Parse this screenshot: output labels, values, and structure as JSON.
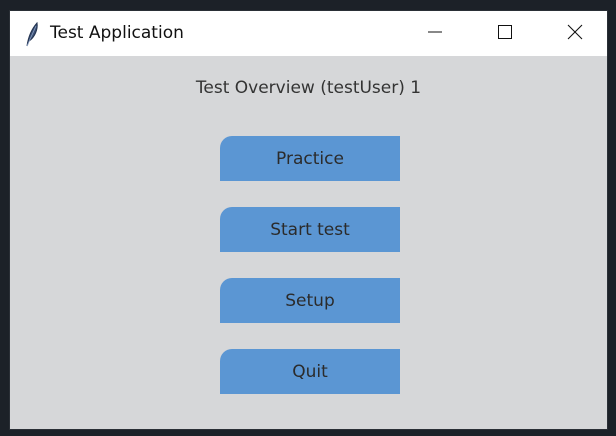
{
  "window": {
    "title": "Test Application",
    "icon": "feather-icon",
    "controls": [
      "minimize-icon",
      "maximize-icon",
      "close-icon"
    ]
  },
  "main": {
    "heading": "Test Overview (testUser) 1",
    "buttons": [
      {
        "label": "Practice"
      },
      {
        "label": "Start test"
      },
      {
        "label": "Setup"
      },
      {
        "label": "Quit"
      }
    ]
  },
  "colors": {
    "background": "#d6d7d9",
    "button": "#5b96d3",
    "titlebar": "#ffffff"
  }
}
